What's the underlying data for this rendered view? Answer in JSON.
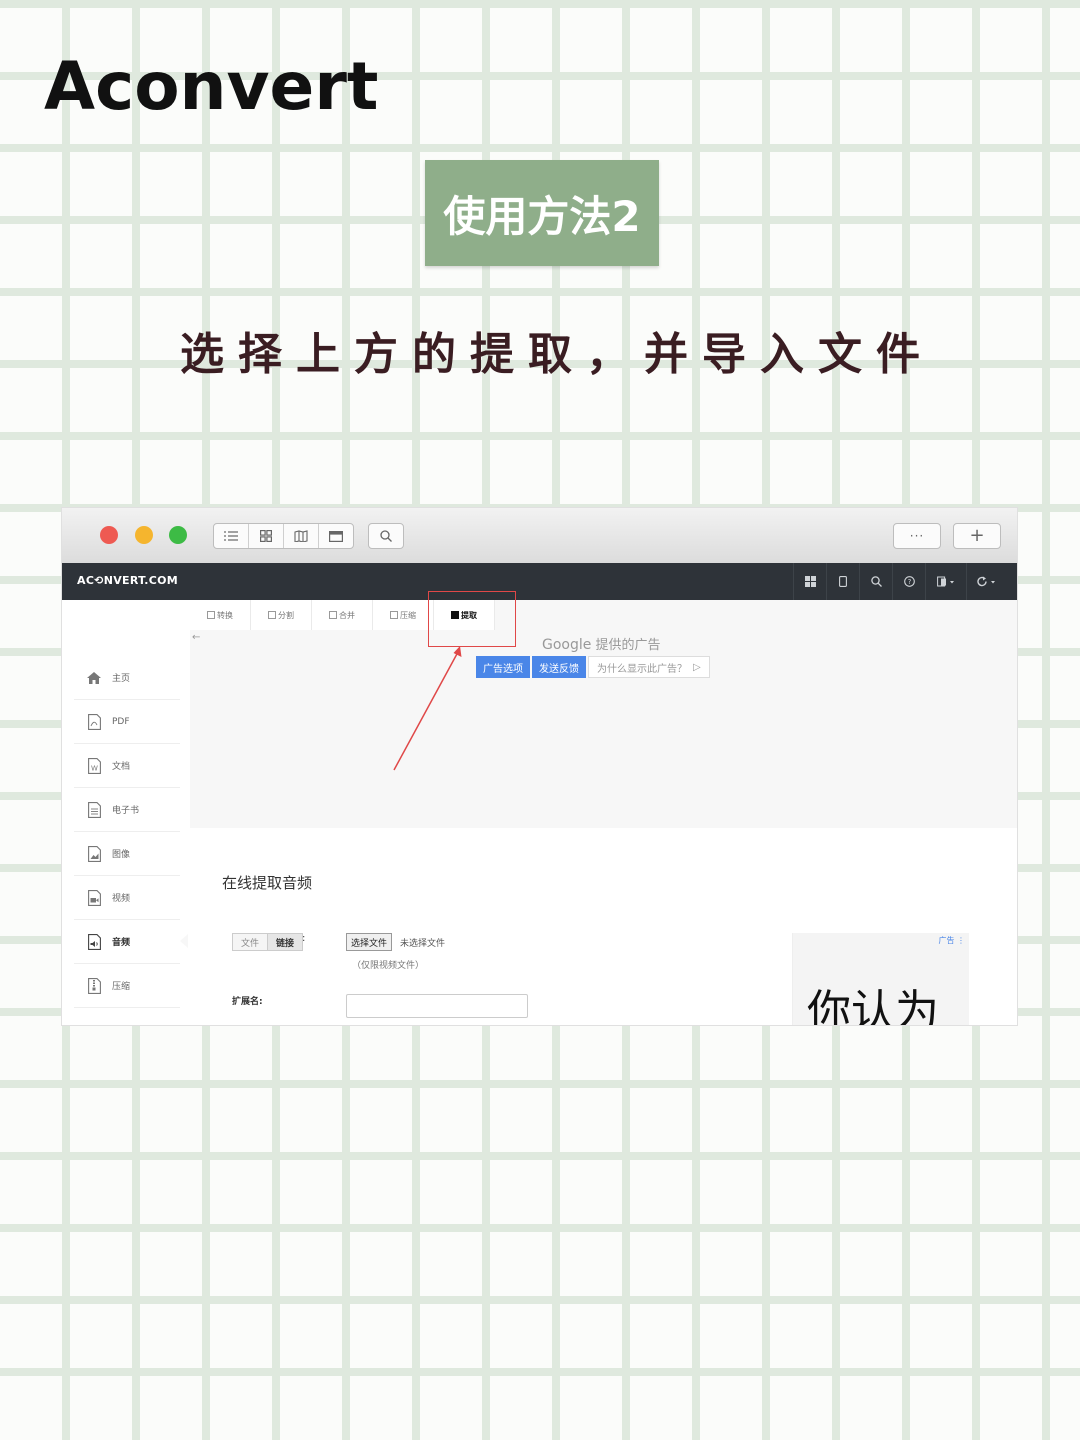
{
  "page": {
    "title": "Aconvert",
    "badge": "使用方法2",
    "instruction": "选择上方的提取，并导入文件"
  },
  "browser": {
    "toolbar_icons": [
      "list-icon",
      "grid-icon",
      "map-icon",
      "window-icon",
      "search-icon",
      "more-icon",
      "plus-icon"
    ],
    "logo": "AC⟲NVERT.COM",
    "nav_icons": [
      "apps-icon",
      "tablet-icon",
      "search-icon",
      "help-icon",
      "language-icon",
      "refresh-icon"
    ]
  },
  "tabs": [
    {
      "label": "转换",
      "active": false
    },
    {
      "label": "分割",
      "active": false
    },
    {
      "label": "合并",
      "active": false
    },
    {
      "label": "压缩",
      "active": false
    },
    {
      "label": "提取",
      "active": true
    }
  ],
  "sidebar": {
    "items": [
      {
        "label": "主页",
        "icon": "home-icon"
      },
      {
        "label": "PDF",
        "icon": "pdf-icon"
      },
      {
        "label": "文档",
        "icon": "word-icon"
      },
      {
        "label": "电子书",
        "icon": "ebook-icon"
      },
      {
        "label": "图像",
        "icon": "image-icon"
      },
      {
        "label": "视频",
        "icon": "video-icon"
      },
      {
        "label": "音频",
        "icon": "audio-icon"
      },
      {
        "label": "压缩",
        "icon": "archive-icon"
      }
    ]
  },
  "ad": {
    "provider": "Google",
    "provider_suffix": "提供的广告",
    "options_button": "广告选项",
    "feedback_button": "发送反馈",
    "why_text": "为什么显示此广告？",
    "tag": "广告",
    "side_text": "你认为"
  },
  "form": {
    "heading": "在线提取音频",
    "source_file": "文件",
    "source_link": "链接",
    "colon": ":",
    "choose_button": "选择文件",
    "file_status": "未选择文件",
    "hint": "（仅限视频文件）",
    "ext_label": "扩展名:"
  },
  "colors": {
    "badge": "#8fae8a",
    "navbar": "#2e3339",
    "highlight": "#e04848",
    "ad_button": "#4a86e8",
    "close": "#ee5a52",
    "minimize": "#f5b52e",
    "zoom": "#3dbb45"
  }
}
